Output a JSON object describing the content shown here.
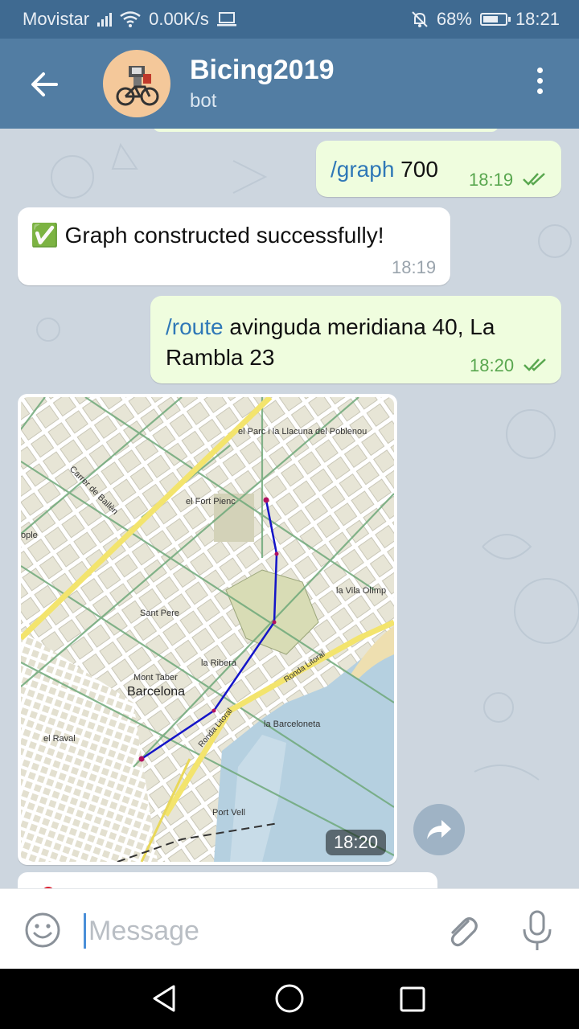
{
  "status_bar": {
    "carrier": "Movistar",
    "speed": "0.00K/s",
    "battery": "68%",
    "battery_level": 0.68,
    "time": "18:21"
  },
  "header": {
    "title": "Bicing2019",
    "subtitle": "bot",
    "back_icon": "arrow-left-icon",
    "menu_icon": "more-vertical-icon"
  },
  "messages": [
    {
      "direction": "out",
      "command": "/graph",
      "text": " 700",
      "time": "18:19",
      "status": "read"
    },
    {
      "direction": "in",
      "emoji": "✅",
      "text": " Graph constructed successfully!",
      "time": "18:19"
    },
    {
      "direction": "out",
      "command": "/route",
      "text": " avinguda meridiana 40, La Rambla 23",
      "time": "18:20",
      "status": "read"
    },
    {
      "direction": "in",
      "type": "image",
      "time": "18:20"
    }
  ],
  "map": {
    "labels": {
      "parc": "el Parc i la Llacuna del Poblenou",
      "bailen": "Carrer de Bailèn",
      "fort_pienc": "el Fort Pienc",
      "ople": "ople",
      "vila_olimp": "la Vila Olímp",
      "sant_pere": "Sant Pere",
      "ribera": "la Ribera",
      "mont_taber": "Mont Taber",
      "barcelona": "Barcelona",
      "ronda_litoral_1": "Ronda Litoral",
      "ronda_litoral_2": "Ronda Litoral",
      "barceloneta": "la Barceloneta",
      "raval": "el Raval",
      "port_vell": "Port Vell"
    },
    "route_color": "#1414c8"
  },
  "composer": {
    "placeholder": "Message"
  },
  "colors": {
    "header": "#527da3",
    "status_bar": "#3f6a91",
    "outgoing_bubble": "#effdde",
    "incoming_bubble": "#ffffff",
    "command_link": "#2f78b7",
    "read_ticks": "#59a74f"
  }
}
